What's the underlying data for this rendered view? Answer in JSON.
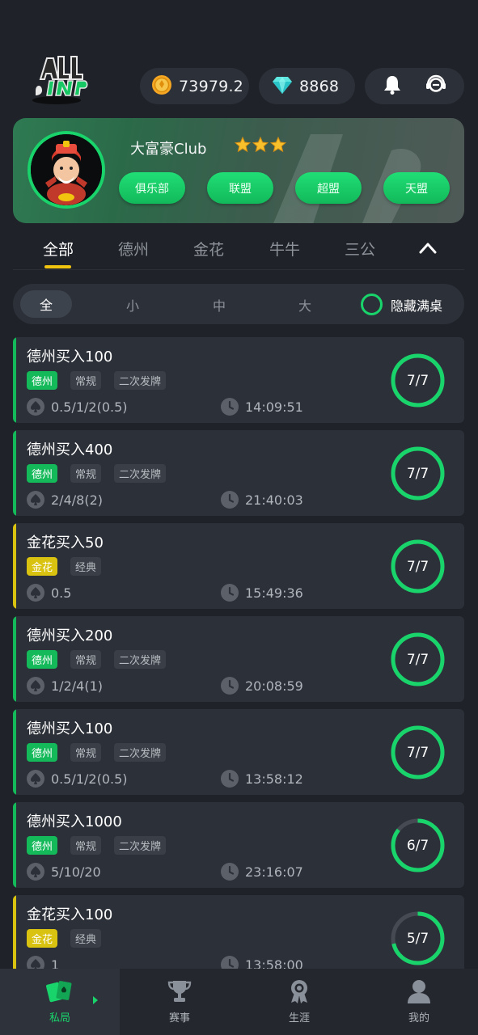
{
  "header": {
    "logo_text": "ALL IN",
    "coins": "73979.2",
    "diamonds": "8868"
  },
  "club": {
    "name": "大富豪Club",
    "stars": 3,
    "buttons": [
      "俱乐部",
      "联盟",
      "超盟",
      "天盟"
    ]
  },
  "game_tabs": {
    "items": [
      "全部",
      "德州",
      "金花",
      "牛牛",
      "三公"
    ],
    "active": "全部"
  },
  "size_filter": {
    "items": [
      "全",
      "小",
      "中",
      "大"
    ],
    "active": "全",
    "hide_full_label": "隐藏满桌"
  },
  "tables": [
    {
      "title": "德州买入100",
      "game": "德州",
      "tags": [
        "常规",
        "二次发牌"
      ],
      "blinds": "0.5/1/2(0.5)",
      "time": "14:09:51",
      "players": "7/7",
      "fill": 1.0
    },
    {
      "title": "德州买入400",
      "game": "德州",
      "tags": [
        "常规",
        "二次发牌"
      ],
      "blinds": "2/4/8(2)",
      "time": "21:40:03",
      "players": "7/7",
      "fill": 1.0
    },
    {
      "title": "金花买入50",
      "game": "金花",
      "tags": [
        "经典"
      ],
      "blinds": "0.5",
      "time": "15:49:36",
      "players": "7/7",
      "fill": 1.0
    },
    {
      "title": "德州买入200",
      "game": "德州",
      "tags": [
        "常规",
        "二次发牌"
      ],
      "blinds": "1/2/4(1)",
      "time": "20:08:59",
      "players": "7/7",
      "fill": 1.0
    },
    {
      "title": "德州买入100",
      "game": "德州",
      "tags": [
        "常规",
        "二次发牌"
      ],
      "blinds": "0.5/1/2(0.5)",
      "time": "13:58:12",
      "players": "7/7",
      "fill": 1.0
    },
    {
      "title": "德州买入1000",
      "game": "德州",
      "tags": [
        "常规",
        "二次发牌"
      ],
      "blinds": "5/10/20",
      "time": "23:16:07",
      "players": "6/7",
      "fill": 0.857
    },
    {
      "title": "金花买入100",
      "game": "金花",
      "tags": [
        "经典"
      ],
      "blinds": "1",
      "time": "13:58:00",
      "players": "5/7",
      "fill": 0.714
    }
  ],
  "nav": {
    "items": [
      "私局",
      "赛事",
      "生涯",
      "我的"
    ],
    "active": "私局"
  },
  "colors": {
    "accent_green": "#19d36b",
    "holdem_bar": "#14b95a",
    "jinhua_bar": "#d9c210",
    "tab_underline": "#f1c40f",
    "background": "#1f2228",
    "card": "#2c3038"
  },
  "icons": {
    "header": [
      "coin-icon",
      "diamond-icon",
      "bell-icon",
      "customer-service-icon"
    ],
    "card": [
      "spade-icon",
      "clock-icon"
    ],
    "nav": [
      "cards-icon",
      "trophy-icon",
      "medal-icon",
      "user-icon"
    ]
  }
}
